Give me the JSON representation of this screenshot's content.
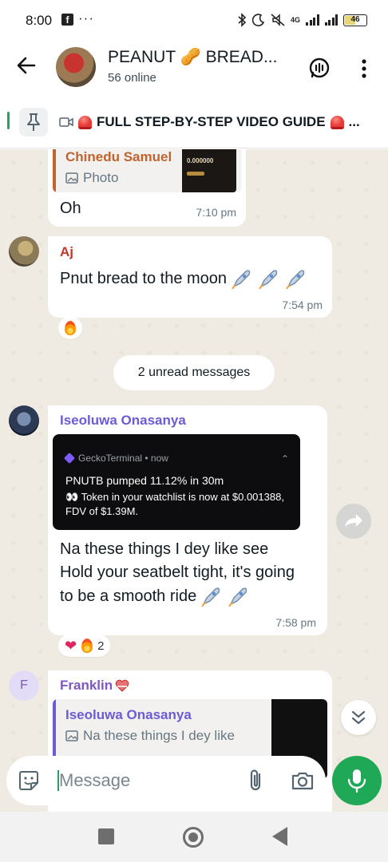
{
  "status_bar": {
    "time": "8:00",
    "fb": "f",
    "dots": "···",
    "net": "4G",
    "battery": "46",
    "battery_level": 0.46
  },
  "header": {
    "title": "PEANUT 🥜 BREAD...",
    "subtitle": "56 online"
  },
  "pinned": {
    "text_prefix": "FULL STEP-BY-STEP VIDEO GUIDE",
    "ellipsis": "..."
  },
  "chat": {
    "msg1": {
      "quoted_name": "Chinedu Samuel",
      "quoted_type": "Photo",
      "thumb_label": "0.000000",
      "text": "Oh",
      "time": "7:10 pm"
    },
    "msg2": {
      "sender": "Aj",
      "text": "Pnut bread to the moon",
      "time": "7:54 pm",
      "reaction_count": ""
    },
    "unread_label": "2 unread messages",
    "msg3": {
      "sender": "Iseoluwa Onasanya",
      "notif_app": "GeckoTerminal • now",
      "notif_title": "PNUTB pumped 11.12% in 30m",
      "notif_body": "👀 Token in your watchlist is now at $0.001388, FDV of $1.39M.",
      "text_line1": "Na these things I dey like see",
      "text_line2": "Hold your seatbelt tight, it's going",
      "text_line3": "to be a smooth ride",
      "time": "7:58 pm",
      "reaction_count": "2"
    },
    "msg4": {
      "sender_initial": "F",
      "sender": "Franklin",
      "quoted_name": "Iseoluwa Onasanya",
      "quoted_text": "Na these things I dey like"
    }
  },
  "input": {
    "placeholder": "Message"
  },
  "colors": {
    "accent_green": "#1fa855",
    "sender_aj": "#c0392b",
    "sender_iseoluwa": "#6b5bd6",
    "sender_franklin": "#7e57c2",
    "quote_bar_chinedu": "#c0642f",
    "quote_bar_iseoluwa": "#6b5bd6"
  },
  "icons": [
    "back-arrow-icon",
    "group-call-icon",
    "more-vert-icon",
    "pin-icon",
    "video-icon",
    "siren-icon",
    "photo-icon",
    "rocket-icon",
    "fire-icon",
    "heart-icon",
    "forward-icon",
    "scroll-down-icon",
    "sticker-icon",
    "attach-icon",
    "camera-icon",
    "mic-icon",
    "recents-icon",
    "home-icon",
    "nav-back-icon"
  ]
}
